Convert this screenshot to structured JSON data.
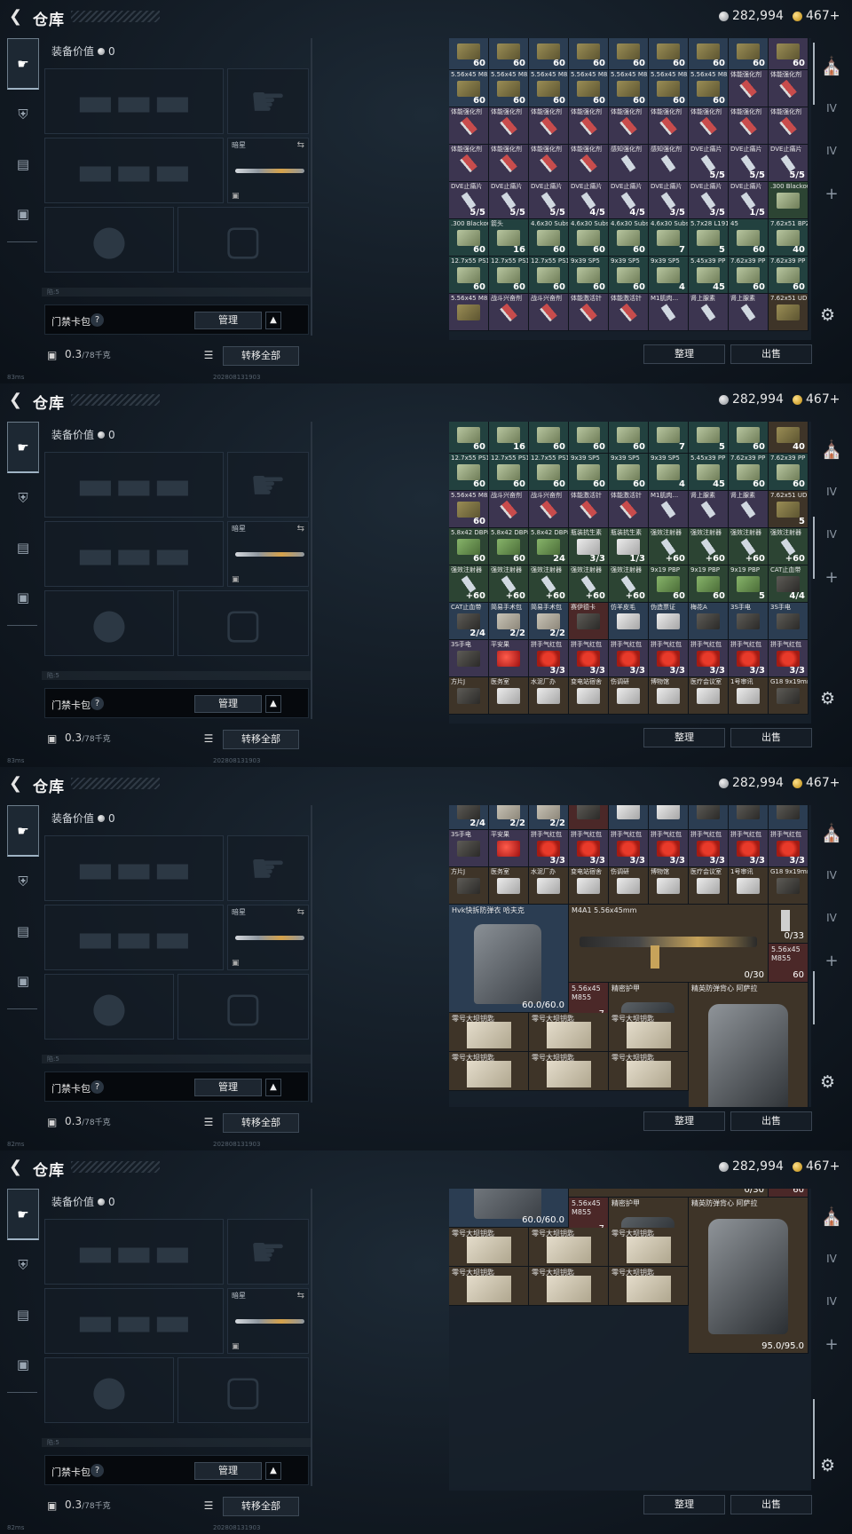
{
  "header": {
    "title": "仓库",
    "silver": "282,994",
    "gold": "467+"
  },
  "equipment": {
    "value_label": "装备价值",
    "value": "0",
    "melee_label": "暗星",
    "separator": "陷:5",
    "keycard_label": "门禁卡包",
    "help": "?",
    "manage_label": "管理",
    "weight": "0.3",
    "weight_max": "/78千克",
    "transfer_label": "转移全部"
  },
  "status": {
    "ping1": "83ms",
    "ping2": "83ms",
    "ping3": "82ms",
    "ping4": "82ms",
    "serial": "202808131903"
  },
  "stash": {
    "sort_label": "整理",
    "sell_label": "出售",
    "frame1": [
      {
        "n": "",
        "q": "60",
        "t": "blue",
        "i": "ammo"
      },
      {
        "n": "",
        "q": "60",
        "t": "blue",
        "i": "ammo"
      },
      {
        "n": "",
        "q": "60",
        "t": "blue",
        "i": "ammo"
      },
      {
        "n": "",
        "q": "60",
        "t": "blue",
        "i": "ammo"
      },
      {
        "n": "",
        "q": "60",
        "t": "blue",
        "i": "ammo"
      },
      {
        "n": "",
        "q": "60",
        "t": "blue",
        "i": "ammo"
      },
      {
        "n": "",
        "q": "60",
        "t": "blue",
        "i": "ammo"
      },
      {
        "n": "",
        "q": "60",
        "t": "blue",
        "i": "ammo"
      },
      {
        "n": "",
        "q": "60",
        "t": "purple",
        "i": "ammo"
      },
      {
        "n": "5.56x45 M855A1",
        "q": "60",
        "t": "blue",
        "i": "ammo"
      },
      {
        "n": "5.56x45 M855A1",
        "q": "60",
        "t": "blue",
        "i": "ammo"
      },
      {
        "n": "5.56x45 M855A1",
        "q": "60",
        "t": "blue",
        "i": "ammo"
      },
      {
        "n": "5.56x45 M855A1",
        "q": "60",
        "t": "blue",
        "i": "ammo"
      },
      {
        "n": "5.56x45 M855A1",
        "q": "60",
        "t": "blue",
        "i": "ammo"
      },
      {
        "n": "5.56x45 M855A1",
        "q": "60",
        "t": "blue",
        "i": "ammo"
      },
      {
        "n": "5.56x45 M855A1",
        "q": "60",
        "t": "blue",
        "i": "ammo"
      },
      {
        "n": "体能强化剂",
        "q": "",
        "t": "purple",
        "i": "syr"
      },
      {
        "n": "体能强化剂",
        "q": "",
        "t": "purple",
        "i": "syr"
      },
      {
        "n": "体能强化剂",
        "q": "",
        "t": "purple",
        "i": "syr"
      },
      {
        "n": "体能强化剂",
        "q": "",
        "t": "purple",
        "i": "syr"
      },
      {
        "n": "体能强化剂",
        "q": "",
        "t": "purple",
        "i": "syr"
      },
      {
        "n": "体能强化剂",
        "q": "",
        "t": "purple",
        "i": "syr"
      },
      {
        "n": "体能强化剂",
        "q": "",
        "t": "purple",
        "i": "syr"
      },
      {
        "n": "体能强化剂",
        "q": "",
        "t": "purple",
        "i": "syr"
      },
      {
        "n": "体能强化剂",
        "q": "",
        "t": "purple",
        "i": "syr"
      },
      {
        "n": "体能强化剂",
        "q": "",
        "t": "purple",
        "i": "syr"
      },
      {
        "n": "体能强化剂",
        "q": "",
        "t": "purple",
        "i": "syr"
      },
      {
        "n": "体能强化剂",
        "q": "",
        "t": "purple",
        "i": "syr"
      },
      {
        "n": "体能强化剂",
        "q": "",
        "t": "purple",
        "i": "syr"
      },
      {
        "n": "体能强化剂",
        "q": "",
        "t": "purple",
        "i": "syr"
      },
      {
        "n": "体能强化剂",
        "q": "",
        "t": "purple",
        "i": "syr"
      },
      {
        "n": "感知强化剂",
        "q": "",
        "t": "purple",
        "i": "inj"
      },
      {
        "n": "感知强化剂",
        "q": "",
        "t": "purple",
        "i": "inj"
      },
      {
        "n": "DVE止痛片",
        "q": "5/5",
        "t": "purple",
        "i": "inj"
      },
      {
        "n": "DVE止痛片",
        "q": "5/5",
        "t": "purple",
        "i": "inj"
      },
      {
        "n": "DVE止痛片",
        "q": "5/5",
        "t": "purple",
        "i": "inj"
      },
      {
        "n": "DVE止痛片",
        "q": "5/5",
        "t": "purple",
        "i": "inj"
      },
      {
        "n": "DVE止痛片",
        "q": "5/5",
        "t": "purple",
        "i": "inj"
      },
      {
        "n": "DVE止痛片",
        "q": "5/5",
        "t": "purple",
        "i": "inj"
      },
      {
        "n": "DVE止痛片",
        "q": "4/5",
        "t": "purple",
        "i": "inj"
      },
      {
        "n": "DVE止痛片",
        "q": "4/5",
        "t": "purple",
        "i": "inj"
      },
      {
        "n": "DVE止痛片",
        "q": "3/5",
        "t": "purple",
        "i": "inj"
      },
      {
        "n": "DVE止痛片",
        "q": "3/5",
        "t": "purple",
        "i": "inj"
      },
      {
        "n": "DVE止痛片",
        "q": "1/5",
        "t": "purple",
        "i": "inj"
      },
      {
        "n": ".300 Blackout V-Max",
        "q": "",
        "t": "green",
        "i": "box"
      },
      {
        "n": ".300 Blackout V-Max",
        "q": "60",
        "t": "teal",
        "i": "box"
      },
      {
        "n": "箭头",
        "q": "16",
        "t": "teal",
        "i": "box"
      },
      {
        "n": "4.6x30 Subsonic",
        "q": "60",
        "t": "teal",
        "i": "box"
      },
      {
        "n": "4.6x30 Subsonic",
        "q": "60",
        "t": "teal",
        "i": "box"
      },
      {
        "n": "4.6x30 Subsonic",
        "q": "60",
        "t": "teal",
        "i": "box"
      },
      {
        "n": "4.6x30 Subsonic",
        "q": "7",
        "t": "teal",
        "i": "box"
      },
      {
        "n": "5.7x28 L191",
        "q": "5",
        "t": "teal",
        "i": "box"
      },
      {
        "n": "45",
        "q": "60",
        "t": "teal",
        "i": "box"
      },
      {
        "n": "7.62x51 BPZ",
        "q": "40",
        "t": "teal",
        "i": "box"
      },
      {
        "n": "12.7x55 PS12A",
        "q": "60",
        "t": "teal",
        "i": "box"
      },
      {
        "n": "12.7x55 PS12A",
        "q": "60",
        "t": "teal",
        "i": "box"
      },
      {
        "n": "12.7x55 PS12A",
        "q": "60",
        "t": "teal",
        "i": "box"
      },
      {
        "n": "9x39 SP5",
        "q": "60",
        "t": "teal",
        "i": "box"
      },
      {
        "n": "9x39 SP5",
        "q": "60",
        "t": "teal",
        "i": "box"
      },
      {
        "n": "9x39 SP5",
        "q": "4",
        "t": "teal",
        "i": "box"
      },
      {
        "n": "5.45x39 PP",
        "q": "45",
        "t": "teal",
        "i": "box"
      },
      {
        "n": "7.62x39 PP",
        "q": "60",
        "t": "teal",
        "i": "box"
      },
      {
        "n": "7.62x39 PP",
        "q": "60",
        "t": "teal",
        "i": "box"
      },
      {
        "n": "5.56x45 M855",
        "q": "",
        "t": "purple",
        "i": "ammo"
      },
      {
        "n": "战斗兴奋剂",
        "q": "",
        "t": "purple",
        "i": "syr"
      },
      {
        "n": "战斗兴奋剂",
        "q": "",
        "t": "purple",
        "i": "syr"
      },
      {
        "n": "体能激活针",
        "q": "",
        "t": "purple",
        "i": "syr"
      },
      {
        "n": "体能激活针",
        "q": "",
        "t": "purple",
        "i": "syr"
      },
      {
        "n": "M1肌肉...",
        "q": "",
        "t": "purple",
        "i": "inj"
      },
      {
        "n": "肾上腺素",
        "q": "",
        "t": "purple",
        "i": "inj"
      },
      {
        "n": "肾上腺素",
        "q": "",
        "t": "purple",
        "i": "inj"
      },
      {
        "n": "7.62x51 UDP",
        "q": "",
        "t": "brown",
        "i": "ammo"
      }
    ],
    "frame2": [
      {
        "n": "",
        "q": "60",
        "t": "teal",
        "i": "box"
      },
      {
        "n": "",
        "q": "16",
        "t": "teal",
        "i": "box"
      },
      {
        "n": "",
        "q": "60",
        "t": "teal",
        "i": "box"
      },
      {
        "n": "",
        "q": "60",
        "t": "teal",
        "i": "box"
      },
      {
        "n": "",
        "q": "60",
        "t": "teal",
        "i": "box"
      },
      {
        "n": "",
        "q": "7",
        "t": "teal",
        "i": "box"
      },
      {
        "n": "",
        "q": "5",
        "t": "teal",
        "i": "box"
      },
      {
        "n": "",
        "q": "60",
        "t": "teal",
        "i": "box"
      },
      {
        "n": "",
        "q": "40",
        "t": "brown",
        "i": "ammo"
      },
      {
        "n": "12.7x55 PS12A",
        "q": "60",
        "t": "teal",
        "i": "box"
      },
      {
        "n": "12.7x55 PS12A",
        "q": "60",
        "t": "teal",
        "i": "box"
      },
      {
        "n": "12.7x55 PS12A",
        "q": "60",
        "t": "teal",
        "i": "box"
      },
      {
        "n": "9x39 SP5",
        "q": "60",
        "t": "teal",
        "i": "box"
      },
      {
        "n": "9x39 SP5",
        "q": "60",
        "t": "teal",
        "i": "box"
      },
      {
        "n": "9x39 SP5",
        "q": "4",
        "t": "teal",
        "i": "box"
      },
      {
        "n": "5.45x39 PP",
        "q": "45",
        "t": "teal",
        "i": "box"
      },
      {
        "n": "7.62x39 PP",
        "q": "60",
        "t": "teal",
        "i": "box"
      },
      {
        "n": "7.62x39 PP",
        "q": "60",
        "t": "teal",
        "i": "box"
      },
      {
        "n": "5.56x45 M855",
        "q": "60",
        "t": "purple",
        "i": "ammo"
      },
      {
        "n": "战斗兴奋剂",
        "q": "",
        "t": "purple",
        "i": "syr"
      },
      {
        "n": "战斗兴奋剂",
        "q": "",
        "t": "purple",
        "i": "syr"
      },
      {
        "n": "体能激活针",
        "q": "",
        "t": "purple",
        "i": "syr"
      },
      {
        "n": "体能激活针",
        "q": "",
        "t": "purple",
        "i": "syr"
      },
      {
        "n": "M1肌肉...",
        "q": "",
        "t": "purple",
        "i": "inj"
      },
      {
        "n": "肾上腺素",
        "q": "",
        "t": "purple",
        "i": "inj"
      },
      {
        "n": "肾上腺素",
        "q": "",
        "t": "purple",
        "i": "inj"
      },
      {
        "n": "7.62x51 UDP",
        "q": "5",
        "t": "brown",
        "i": "ammo"
      },
      {
        "n": "5.8x42 DBP87",
        "q": "60",
        "t": "green",
        "i": "grn"
      },
      {
        "n": "5.8x42 DBP87",
        "q": "60",
        "t": "green",
        "i": "grn"
      },
      {
        "n": "5.8x42 DBP87",
        "q": "24",
        "t": "green",
        "i": "grn"
      },
      {
        "n": "瓶装抗生素",
        "q": "3/3",
        "t": "green",
        "i": "white"
      },
      {
        "n": "瓶装抗生素",
        "q": "1/3",
        "t": "green",
        "i": "white"
      },
      {
        "n": "强效注射器",
        "q": "+60",
        "t": "green",
        "i": "inj"
      },
      {
        "n": "强效注射器",
        "q": "+60",
        "t": "green",
        "i": "inj"
      },
      {
        "n": "强效注射器",
        "q": "+60",
        "t": "green",
        "i": "inj"
      },
      {
        "n": "强效注射器",
        "q": "+60",
        "t": "green",
        "i": "inj"
      },
      {
        "n": "强效注射器",
        "q": "+60",
        "t": "green",
        "i": "inj"
      },
      {
        "n": "强效注射器",
        "q": "+60",
        "t": "green",
        "i": "inj"
      },
      {
        "n": "强效注射器",
        "q": "+60",
        "t": "green",
        "i": "inj"
      },
      {
        "n": "强效注射器",
        "q": "+60",
        "t": "green",
        "i": "inj"
      },
      {
        "n": "强效注射器",
        "q": "+60",
        "t": "green",
        "i": "inj"
      },
      {
        "n": "9x19 PBP",
        "q": "60",
        "t": "green",
        "i": "grn"
      },
      {
        "n": "9x19 PBP",
        "q": "60",
        "t": "green",
        "i": "grn"
      },
      {
        "n": "9x19 PBP",
        "q": "5",
        "t": "green",
        "i": "grn"
      },
      {
        "n": "CAT止血带",
        "q": "4/4",
        "t": "green",
        "i": "bag"
      },
      {
        "n": "CAT止血带",
        "q": "2/4",
        "t": "blue",
        "i": "bag"
      },
      {
        "n": "简易手术包",
        "q": "2/2",
        "t": "blue",
        "i": "pack"
      },
      {
        "n": "简易手术包",
        "q": "2/2",
        "t": "blue",
        "i": "pack"
      },
      {
        "n": "赛伊德卡",
        "q": "",
        "t": "red",
        "i": "bag"
      },
      {
        "n": "仿羊皮毛",
        "q": "",
        "t": "blue",
        "i": "white"
      },
      {
        "n": "伪造票证",
        "q": "",
        "t": "blue",
        "i": "white"
      },
      {
        "n": "梅花A",
        "q": "",
        "t": "blue",
        "i": "bag"
      },
      {
        "n": "3S手电",
        "q": "",
        "t": "blue",
        "i": "bag"
      },
      {
        "n": "3S手电",
        "q": "",
        "t": "blue",
        "i": "bag"
      },
      {
        "n": "3S手电",
        "q": "",
        "t": "purple",
        "i": "bag"
      },
      {
        "n": "平安果",
        "q": "",
        "t": "purple",
        "i": "apple"
      },
      {
        "n": "拼手气红包",
        "q": "3/3",
        "t": "purple",
        "i": "red"
      },
      {
        "n": "拼手气红包",
        "q": "3/3",
        "t": "purple",
        "i": "red"
      },
      {
        "n": "拼手气红包",
        "q": "3/3",
        "t": "purple",
        "i": "red"
      },
      {
        "n": "拼手气红包",
        "q": "3/3",
        "t": "purple",
        "i": "red"
      },
      {
        "n": "拼手气红包",
        "q": "3/3",
        "t": "purple",
        "i": "red"
      },
      {
        "n": "拼手气红包",
        "q": "3/3",
        "t": "purple",
        "i": "red"
      },
      {
        "n": "拼手气红包",
        "q": "3/3",
        "t": "purple",
        "i": "red"
      },
      {
        "n": "方片J",
        "q": "",
        "t": "brown",
        "i": "bag"
      },
      {
        "n": "医务室",
        "q": "",
        "t": "brown",
        "i": "white"
      },
      {
        "n": "水泥厂办",
        "q": "",
        "t": "brown",
        "i": "white"
      },
      {
        "n": "变电站宿舍",
        "q": "",
        "t": "brown",
        "i": "white"
      },
      {
        "n": "伤调研",
        "q": "",
        "t": "brown",
        "i": "white"
      },
      {
        "n": "博物馆",
        "q": "",
        "t": "brown",
        "i": "white"
      },
      {
        "n": "医疗会议室",
        "q": "",
        "t": "brown",
        "i": "white"
      },
      {
        "n": "1号审讯",
        "q": "",
        "t": "brown",
        "i": "white"
      },
      {
        "n": "G18 9x19mm",
        "q": "",
        "t": "brown",
        "i": "bag"
      }
    ],
    "frame3_small": [
      {
        "n": "",
        "q": "2/4",
        "t": "blue",
        "i": "bag"
      },
      {
        "n": "",
        "q": "2/2",
        "t": "blue",
        "i": "pack"
      },
      {
        "n": "",
        "q": "2/2",
        "t": "blue",
        "i": "pack"
      },
      {
        "n": "",
        "q": "",
        "t": "red",
        "i": "bag"
      },
      {
        "n": "",
        "q": "",
        "t": "blue",
        "i": "white"
      },
      {
        "n": "",
        "q": "",
        "t": "blue",
        "i": "white"
      },
      {
        "n": "",
        "q": "",
        "t": "blue",
        "i": "bag"
      },
      {
        "n": "",
        "q": "",
        "t": "blue",
        "i": "bag"
      },
      {
        "n": "",
        "q": "",
        "t": "blue",
        "i": "bag"
      },
      {
        "n": "3S手电",
        "q": "",
        "t": "purple",
        "i": "bag"
      },
      {
        "n": "平安果",
        "q": "",
        "t": "purple",
        "i": "apple"
      },
      {
        "n": "拼手气红包",
        "q": "3/3",
        "t": "purple",
        "i": "red"
      },
      {
        "n": "拼手气红包",
        "q": "3/3",
        "t": "purple",
        "i": "red"
      },
      {
        "n": "拼手气红包",
        "q": "3/3",
        "t": "purple",
        "i": "red"
      },
      {
        "n": "拼手气红包",
        "q": "3/3",
        "t": "purple",
        "i": "red"
      },
      {
        "n": "拼手气红包",
        "q": "3/3",
        "t": "purple",
        "i": "red"
      },
      {
        "n": "拼手气红包",
        "q": "3/3",
        "t": "purple",
        "i": "red"
      },
      {
        "n": "拼手气红包",
        "q": "3/3",
        "t": "purple",
        "i": "red"
      },
      {
        "n": "方片J",
        "q": "",
        "t": "brown",
        "i": "bag"
      },
      {
        "n": "医务室",
        "q": "",
        "t": "brown",
        "i": "white"
      },
      {
        "n": "水泥厂办",
        "q": "",
        "t": "brown",
        "i": "white"
      },
      {
        "n": "变电站宿舍",
        "q": "",
        "t": "brown",
        "i": "white"
      },
      {
        "n": "伤调研",
        "q": "",
        "t": "brown",
        "i": "white"
      },
      {
        "n": "博物馆",
        "q": "",
        "t": "brown",
        "i": "white"
      },
      {
        "n": "医疗会议室",
        "q": "",
        "t": "brown",
        "i": "white"
      },
      {
        "n": "1号审讯",
        "q": "",
        "t": "brown",
        "i": "white"
      },
      {
        "n": "G18 9x19mm",
        "q": "",
        "t": "brown",
        "i": "bag"
      }
    ],
    "big_items": {
      "vest_name": "Hvk快拆防弹衣 哈夫克",
      "vest_dur": "60.0/60.0",
      "rifle_name": "M4A1 5.56x45mm",
      "rifle_ammo": "0/30",
      "pistol_ammo": "0/33",
      "ammo_name": "5.56x45 M855",
      "ammo_q": "60",
      "ammo2_name": "5.56x45 M855",
      "ammo2_q": "7",
      "armor_name": "精密护甲",
      "armor_val": "120",
      "heavy_name": "精英防弹背心 阿萨拉",
      "heavy_dur": "95.0/95.0",
      "doc_name": "零号大坝钥匙"
    }
  },
  "rail": {
    "pill1": "IV",
    "pill2": "IV"
  },
  "colors": {
    "accent": "#9fb3c4",
    "blue": "#2b3d52",
    "purple": "#3c3550",
    "green": "#2c4433",
    "brown": "#3e3428"
  }
}
